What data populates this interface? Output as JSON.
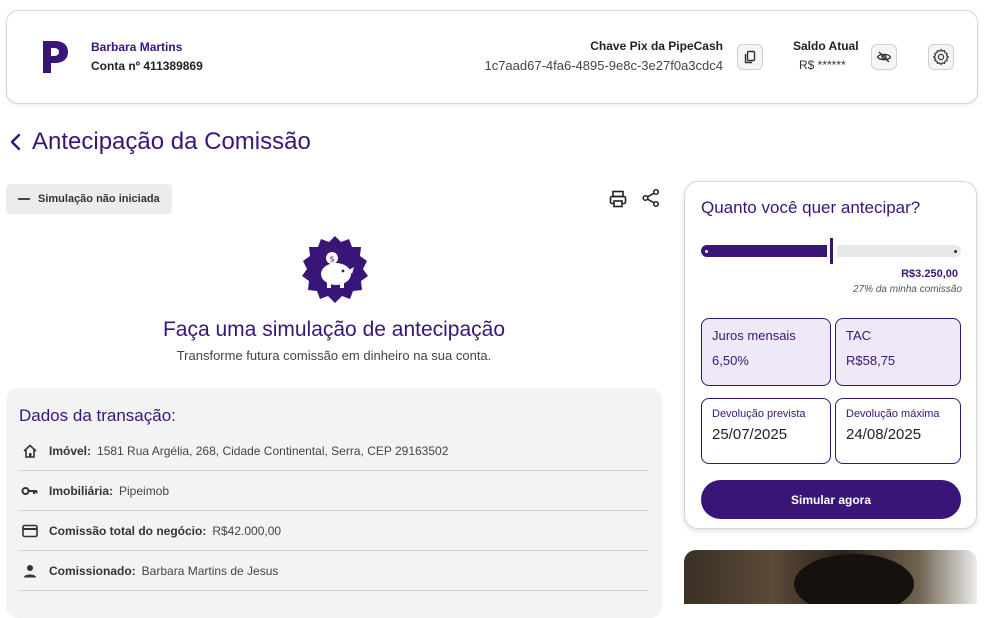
{
  "header": {
    "user_name": "Barbara Martins",
    "account": "Conta nº 411389869",
    "pix_title": "Chave Pix da PipeCash",
    "pix_key": "1c7aad67-4fa6-4895-9e8c-3e27f0a3cdc4",
    "balance_title": "Saldo Atual",
    "balance_value": "R$ ******",
    "icons": [
      "pipecash-logo",
      "copy-icon",
      "eye-off-icon",
      "gear-icon"
    ]
  },
  "page": {
    "title": "Antecipação da Comissão",
    "status": "Simulação não iniciada"
  },
  "empty_state": {
    "title": "Faça uma simulação de antecipação",
    "subtitle": "Transforme futura comissão em dinheiro na sua conta."
  },
  "transaction": {
    "title": "Dados da transação:",
    "rows": [
      {
        "icon": "home-icon",
        "label": "Imóvel:",
        "value": "1581 Rua Argélia, 268, Cidade Continental, Serra, CEP 29163502"
      },
      {
        "icon": "key-icon",
        "label": "Imobiliária:",
        "value": "Pipeimob"
      },
      {
        "icon": "card-icon",
        "label": "Comissão total do negócio:",
        "value": "R$42.000,00"
      },
      {
        "icon": "person-icon",
        "label": "Comissionado:",
        "value": "Barbara Martins de Jesus"
      }
    ]
  },
  "simulation": {
    "title": "Quanto você quer antecipar?",
    "slider_fraction": 0.5,
    "amount": "R$3.250,00",
    "percent_text": "27% da minha comissão",
    "tiles": [
      {
        "label": "Juros mensais",
        "value": "6,50%"
      },
      {
        "label": "TAC",
        "value": "R$58,75"
      },
      {
        "label": "Devolução prevista",
        "value": "25/07/2025"
      },
      {
        "label": "Devolução máxima",
        "value": "24/08/2025"
      }
    ],
    "button": "Simular agora"
  },
  "colors": {
    "primary": "#3a1578",
    "tile_fill": "#efe8f6",
    "card_bg": "#f3f3f3"
  }
}
